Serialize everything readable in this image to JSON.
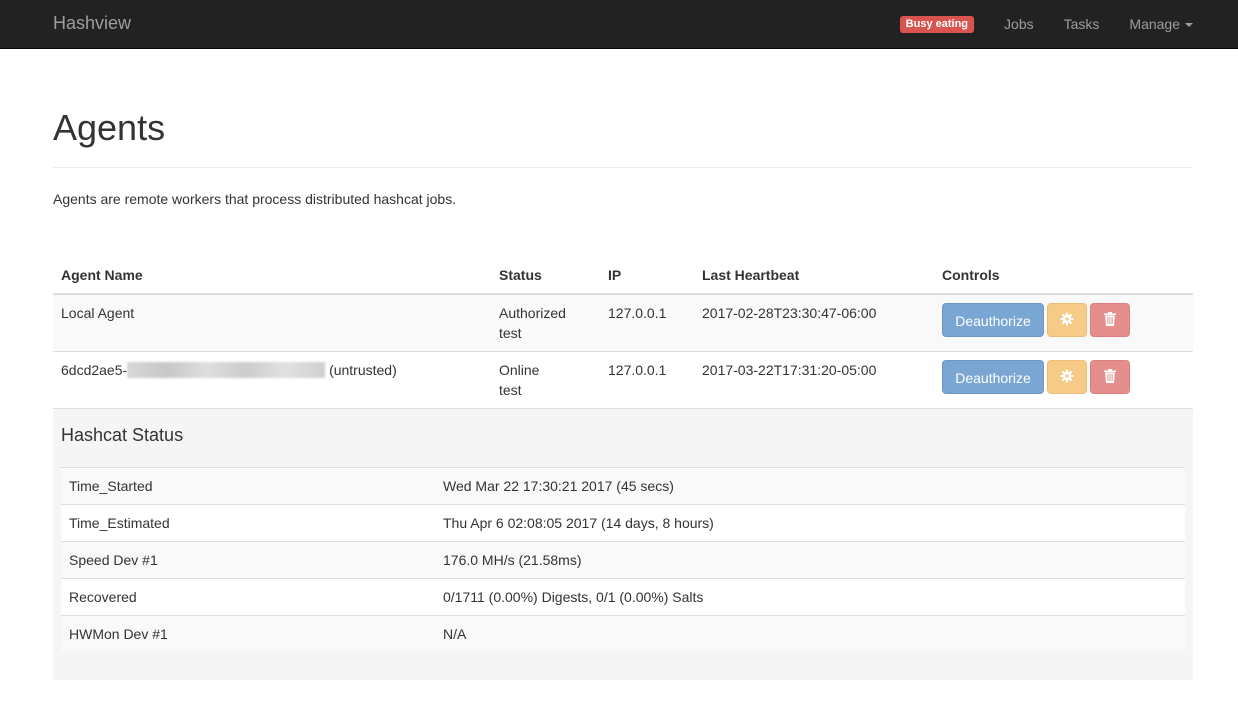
{
  "navbar": {
    "brand": "Hashview",
    "status_label": "Busy eating",
    "links": [
      "Jobs",
      "Tasks",
      "Manage"
    ]
  },
  "page": {
    "title": "Agents",
    "description": "Agents are remote workers that process distributed hashcat jobs."
  },
  "agents_table": {
    "headers": [
      "Agent Name",
      "Status",
      "IP",
      "Last Heartbeat",
      "Controls"
    ],
    "rows": [
      {
        "name": "Local Agent",
        "name_suffix": "",
        "status_line1": "Authorized",
        "status_line2": "test",
        "ip": "127.0.0.1",
        "heartbeat": "2017-02-28T23:30:47-06:00",
        "button_label": "Deauthorize"
      },
      {
        "name": "6dcd2ae5-",
        "name_suffix": "(untrusted)",
        "status_line1": "Online",
        "status_line2": "test",
        "ip": "127.0.0.1",
        "heartbeat": "2017-03-22T17:31:20-05:00",
        "button_label": "Deauthorize"
      }
    ]
  },
  "hashcat_status": {
    "title": "Hashcat Status",
    "rows": [
      {
        "key": "Time_Started",
        "value": "Wed Mar 22 17:30:21 2017 (45 secs)"
      },
      {
        "key": "Time_Estimated",
        "value": "Thu Apr 6 02:08:05 2017 (14 days, 8 hours)"
      },
      {
        "key": "Speed Dev #1",
        "value": "176.0 MH/s (21.58ms)"
      },
      {
        "key": "Recovered",
        "value": "0/1711 (0.00%) Digests, 0/1 (0.00%) Salts"
      },
      {
        "key": "HWMon Dev #1",
        "value": "N/A"
      }
    ]
  },
  "icons": {
    "settings": "gear-icon",
    "delete": "trash-icon"
  },
  "colors": {
    "navbar_bg": "#222222",
    "label_danger": "#d9534f",
    "btn_primary": "#7aa6d3",
    "btn_warning": "#f6cb88",
    "btn_danger": "#e58f8d"
  }
}
